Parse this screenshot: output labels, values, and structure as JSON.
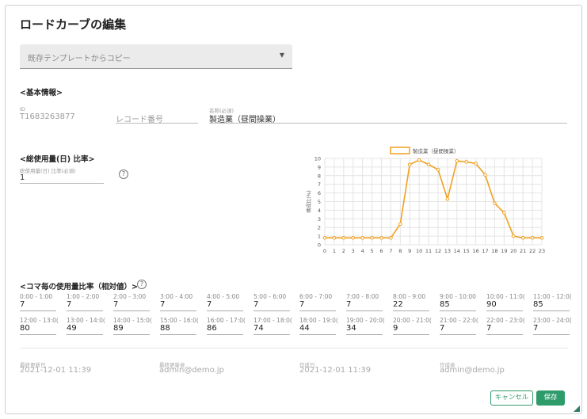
{
  "title": "ロードカーブの編集",
  "template_select": {
    "placeholder": "既存テンプレートからコピー"
  },
  "basic_info": {
    "heading": "<基本情報>",
    "id_label": "ID",
    "id_value": "T1683263877",
    "record_label": "レコード番号",
    "name_label": "名称(必須)",
    "name_value": "製造業（昼間操業）"
  },
  "daily_usage": {
    "heading": "<総使用量(日) 比率>",
    "field_label": "総使用量(日) 比率(必須)",
    "field_value": "1"
  },
  "hourly": {
    "heading": "<コマ毎の使用量比率（相対値）>",
    "slots": [
      {
        "label": "0:00 - 1:00",
        "value": "7"
      },
      {
        "label": "1:00 - 2:00",
        "value": "7"
      },
      {
        "label": "2:00 - 3:00",
        "value": "7"
      },
      {
        "label": "3:00 - 4:00",
        "value": "7"
      },
      {
        "label": "4:00 - 5:00",
        "value": "7"
      },
      {
        "label": "5:00 - 6:00",
        "value": "7"
      },
      {
        "label": "6:00 - 7:00",
        "value": "7"
      },
      {
        "label": "7:00 - 8:00",
        "value": "7"
      },
      {
        "label": "8:00 - 9:00",
        "value": "22"
      },
      {
        "label": "9:00 - 10:00",
        "value": "85"
      },
      {
        "label": "10:00 - 11:0(",
        "value": "90"
      },
      {
        "label": "11:00 - 12:0(",
        "value": "85"
      },
      {
        "label": "12:00 - 13:0(",
        "value": "80"
      },
      {
        "label": "13:00 - 14:0(",
        "value": "49"
      },
      {
        "label": "14:00 - 15:0(",
        "value": "89"
      },
      {
        "label": "15:00 - 16:0(",
        "value": "88"
      },
      {
        "label": "16:00 - 17:0(",
        "value": "86"
      },
      {
        "label": "17:00 - 18:0(",
        "value": "74"
      },
      {
        "label": "18:00 - 19:0(",
        "value": "44"
      },
      {
        "label": "19:00 - 20:0(",
        "value": "34"
      },
      {
        "label": "20:00 - 21:0(",
        "value": "9"
      },
      {
        "label": "21:00 - 22:0(",
        "value": "7"
      },
      {
        "label": "22:00 - 23:0(",
        "value": "7"
      },
      {
        "label": "23:00 - 24:0(",
        "value": "7"
      }
    ]
  },
  "meta": {
    "updated_at_label": "最終更新日",
    "updated_at": "2021-12-01 11:39",
    "updated_by_label": "最終更新者",
    "updated_by": "admin@demo.jp",
    "created_at_label": "作成日",
    "created_at": "2021-12-01 11:39",
    "created_by_label": "作成者",
    "created_by": "admin@demo.jp"
  },
  "buttons": {
    "cancel": "キャンセル",
    "save": "保存"
  },
  "colors": {
    "accent": "#2e9b6a",
    "series": "#f0a020"
  },
  "chart_data": {
    "type": "line",
    "legend": "製造業（昼間操業）",
    "ylabel": "構成比(%)",
    "xlabel": "",
    "x": [
      0,
      1,
      2,
      3,
      4,
      5,
      6,
      7,
      8,
      9,
      10,
      11,
      12,
      13,
      14,
      15,
      16,
      17,
      18,
      19,
      20,
      21,
      22,
      23
    ],
    "series": [
      {
        "name": "製造業（昼間操業）",
        "values": [
          0.8,
          0.8,
          0.8,
          0.8,
          0.8,
          0.8,
          0.8,
          0.8,
          2.4,
          9.3,
          9.8,
          9.3,
          8.7,
          5.3,
          9.7,
          9.6,
          9.4,
          8.1,
          4.8,
          3.7,
          1.0,
          0.8,
          0.8,
          0.8
        ]
      }
    ],
    "ylim": [
      0,
      10
    ],
    "yticks": [
      0,
      1,
      2,
      3,
      4,
      5,
      6,
      7,
      8,
      9,
      10
    ],
    "grid": true,
    "legend_position": "top-center"
  }
}
